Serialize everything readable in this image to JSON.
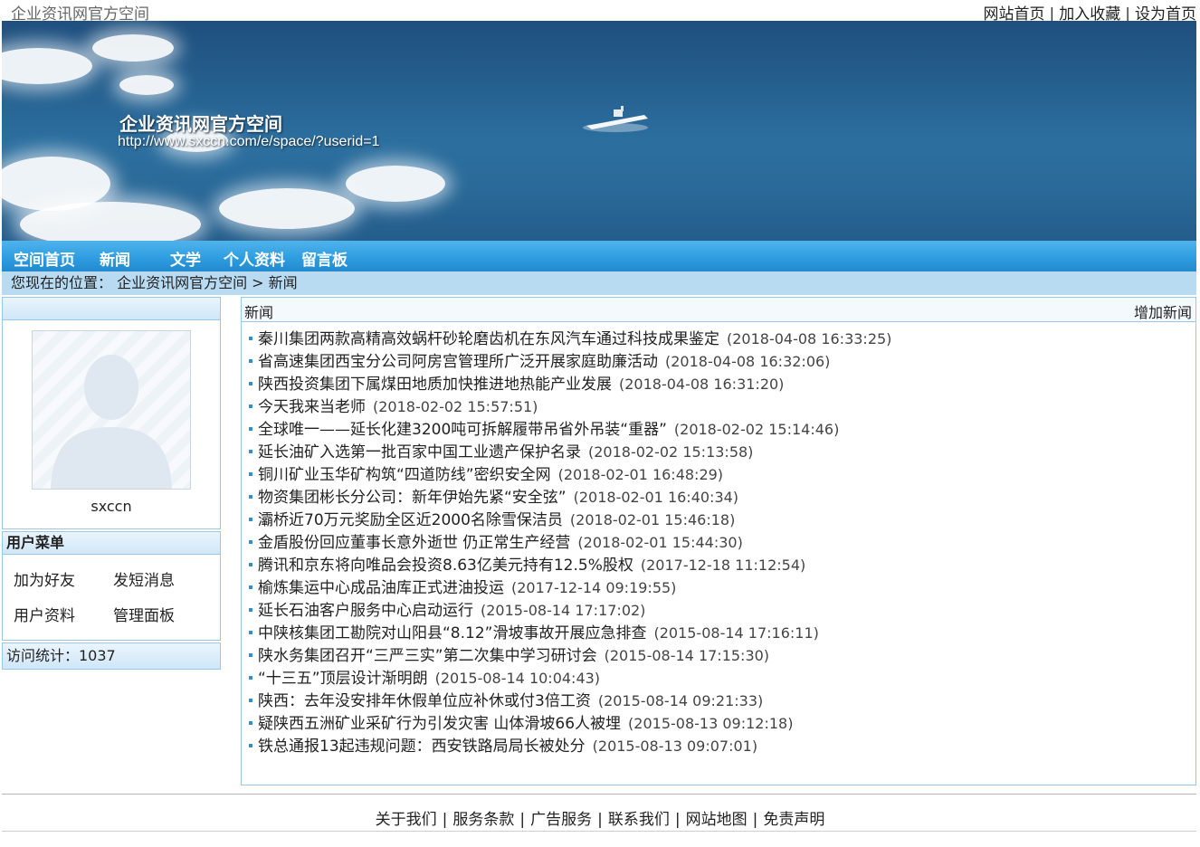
{
  "header": {
    "site_name": "企业资讯网官方空间",
    "links": [
      "网站首页",
      "加入收藏",
      "设为首页"
    ]
  },
  "banner": {
    "title": "企业资讯网官方空间",
    "url": "http://www.sxccn.com/e/space/?userid=1"
  },
  "nav": {
    "items": [
      "空间首页",
      "新闻",
      "文学",
      "个人资料",
      "留言板"
    ]
  },
  "breadcrumb": {
    "text": "您现在的位置： 企业资讯网官方空间 > 新闻"
  },
  "sidebar": {
    "username": "sxccn",
    "menu_title": "用户菜单",
    "menu_items": [
      "加为好友",
      "发短消息",
      "用户资料",
      "管理面板"
    ],
    "stats": "访问统计：1037"
  },
  "main": {
    "title": "新闻",
    "add_link": "增加新闻",
    "news": [
      {
        "title": "秦川集团两款高精高效蜗杆砂轮磨齿机在东风汽车通过科技成果鉴定",
        "date": "(2018-04-08 16:33:25)"
      },
      {
        "title": "省高速集团西宝分公司阿房宫管理所广泛开展家庭助廉活动",
        "date": "(2018-04-08 16:32:06)"
      },
      {
        "title": "陕西投资集团下属煤田地质加快推进地热能产业发展",
        "date": "(2018-04-08 16:31:20)"
      },
      {
        "title": "今天我来当老师",
        "date": "(2018-02-02 15:57:51)"
      },
      {
        "title": "全球唯一——延长化建3200吨可拆解履带吊省外吊装“重器”",
        "date": "(2018-02-02 15:14:46)"
      },
      {
        "title": "延长油矿入选第一批百家中国工业遗产保护名录",
        "date": "(2018-02-02 15:13:58)"
      },
      {
        "title": "铜川矿业玉华矿构筑“四道防线”密织安全网",
        "date": "(2018-02-01 16:48:29)"
      },
      {
        "title": "物资集团彬长分公司：新年伊始先紧“安全弦”",
        "date": "(2018-02-01 16:40:34)"
      },
      {
        "title": "灞桥近70万元奖励全区近2000名除雪保洁员",
        "date": "(2018-02-01 15:46:18)"
      },
      {
        "title": "金盾股份回应董事长意外逝世 仍正常生产经营",
        "date": "(2018-02-01 15:44:30)"
      },
      {
        "title": "腾讯和京东将向唯品会投资8.63亿美元持有12.5%股权",
        "date": "(2017-12-18 11:12:54)"
      },
      {
        "title": "榆炼集运中心成品油库正式进油投运",
        "date": "(2017-12-14 09:19:55)"
      },
      {
        "title": "延长石油客户服务中心启动运行",
        "date": "(2015-08-14 17:17:02)"
      },
      {
        "title": "中陕核集团工勘院对山阳县“8.12”滑坡事故开展应急排查",
        "date": "(2015-08-14 17:16:11)"
      },
      {
        "title": "陕水务集团召开“三严三实”第二次集中学习研讨会",
        "date": "(2015-08-14 17:15:30)"
      },
      {
        "title": "“十三五”顶层设计渐明朗",
        "date": "(2015-08-14 10:04:43)"
      },
      {
        "title": "陕西：去年没安排年休假单位应补休或付3倍工资",
        "date": "(2015-08-14 09:21:33)"
      },
      {
        "title": "疑陕西五洲矿业采矿行为引发灾害 山体滑坡66人被埋",
        "date": "(2015-08-13 09:12:18)"
      },
      {
        "title": "铁总通报13起违规问题：西安铁路局局长被处分",
        "date": "(2015-08-13 09:07:01)"
      }
    ]
  },
  "footer": {
    "links": [
      "关于我们",
      "服务条款",
      "广告服务",
      "联系我们",
      "网站地图",
      "免责声明"
    ]
  }
}
